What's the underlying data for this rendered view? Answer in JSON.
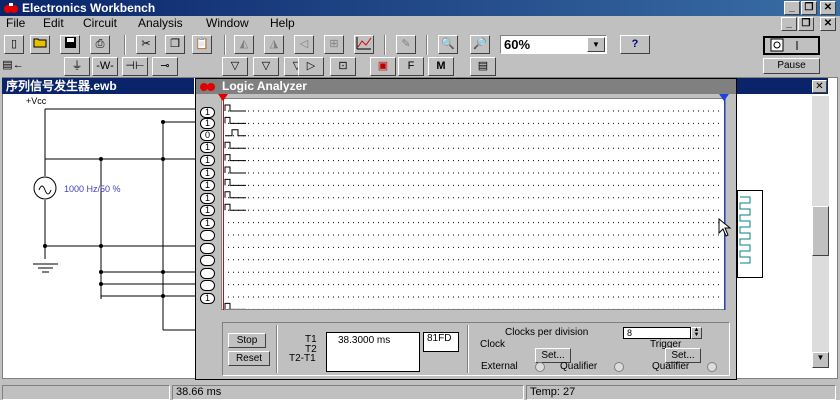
{
  "app": {
    "title": "Electronics Workbench"
  },
  "window_controls": {
    "minimize": "_",
    "restore": "❐",
    "close": "✕"
  },
  "menu": [
    "File",
    "Edit",
    "Circuit",
    "Analysis",
    "Window",
    "Help"
  ],
  "toolbar": {
    "zoom_value": "60%",
    "help_label": "?",
    "pause_label": "Pause",
    "icons_row1": [
      "new-icon",
      "open-icon",
      "save-icon",
      "print-icon",
      "cut-icon",
      "copy-icon",
      "paste-icon",
      "rotate-icon",
      "flip-h-icon",
      "flip-v-icon",
      "subcircuit-icon",
      "graph-icon",
      "component-props-icon",
      "zoom-out-icon",
      "zoom-in-icon"
    ],
    "icons_row2": [
      "parts-bin-icon",
      "sources-icon",
      "basic-icon",
      "diodes-icon",
      "transistors-icon",
      "analog-ic-icon",
      "mixed-ic-icon",
      "digital-ic-icon",
      "logic-gates-icon",
      "digital-icon",
      "indicators-icon",
      "controls-icon",
      "misc-icon",
      "instruments-icon"
    ],
    "icons_row2_glyphs": [
      "▤←",
      "⏚",
      "-W-",
      "⊣⊢",
      "⊸",
      "▽",
      "▽",
      "▽",
      "▷",
      "⊡",
      "▣",
      "F",
      "M",
      "▤"
    ]
  },
  "circuit": {
    "window_title": "序列信号发生器.ewb",
    "vcc_label": "+Vcc",
    "source_label": "1000  Hz/50 %"
  },
  "logic_analyzer": {
    "title": "Logic Analyzer",
    "channels": [
      "1",
      "1",
      "0",
      "1",
      "1",
      "1",
      "1",
      "1",
      "1",
      "1",
      "",
      "",
      "",
      "",
      "",
      "",
      "1"
    ],
    "stop_label": "Stop",
    "reset_label": "Reset",
    "t1_label": "T1",
    "t2_label": "T2",
    "t2t1_label": "T2-T1",
    "time_value": "38.3000  ms",
    "hex_value": "81FD",
    "clocks_per_division_label": "Clocks per division",
    "clocks_per_division_value": "8",
    "clock_label": "Clock",
    "trigger_label": "Trigger",
    "set_label": "Set...",
    "external_label": "External",
    "qualifier_label": "Qualifier"
  },
  "status": {
    "time": "38.66 ms",
    "temp": "Temp:  27"
  }
}
